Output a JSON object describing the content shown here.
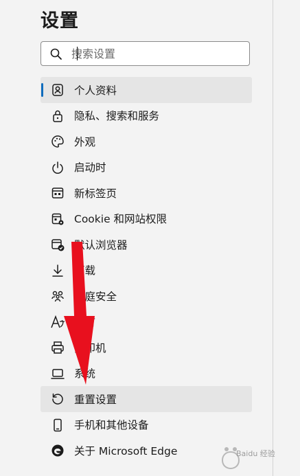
{
  "page_title": "设置",
  "search": {
    "placeholder": "搜索设置"
  },
  "nav": {
    "items": [
      {
        "label": "个人资料",
        "icon": "profile-icon"
      },
      {
        "label": "隐私、搜索和服务",
        "icon": "lock-icon"
      },
      {
        "label": "外观",
        "icon": "palette-icon"
      },
      {
        "label": "启动时",
        "icon": "power-icon"
      },
      {
        "label": "新标签页",
        "icon": "new-tab-icon"
      },
      {
        "label": "Cookie 和网站权限",
        "icon": "site-permissions-icon"
      },
      {
        "label": "默认浏览器",
        "icon": "default-browser-icon"
      },
      {
        "label": "下载",
        "icon": "download-icon"
      },
      {
        "label": "家庭安全",
        "icon": "family-icon"
      },
      {
        "label": "语言",
        "icon": "language-icon"
      },
      {
        "label": "打印机",
        "icon": "printer-icon"
      },
      {
        "label": "系统",
        "icon": "laptop-icon"
      },
      {
        "label": "重置设置",
        "icon": "reset-icon"
      },
      {
        "label": "手机和其他设备",
        "icon": "phone-icon"
      },
      {
        "label": "关于 Microsoft Edge",
        "icon": "edge-logo-icon"
      }
    ],
    "selected_index": 0,
    "highlighted_index": 12
  },
  "colors": {
    "accent": "#0f6cbd",
    "selected_bg": "#e5e5e5",
    "arrow": "#e8101e"
  },
  "watermark": {
    "text": "Baidu 经验"
  }
}
